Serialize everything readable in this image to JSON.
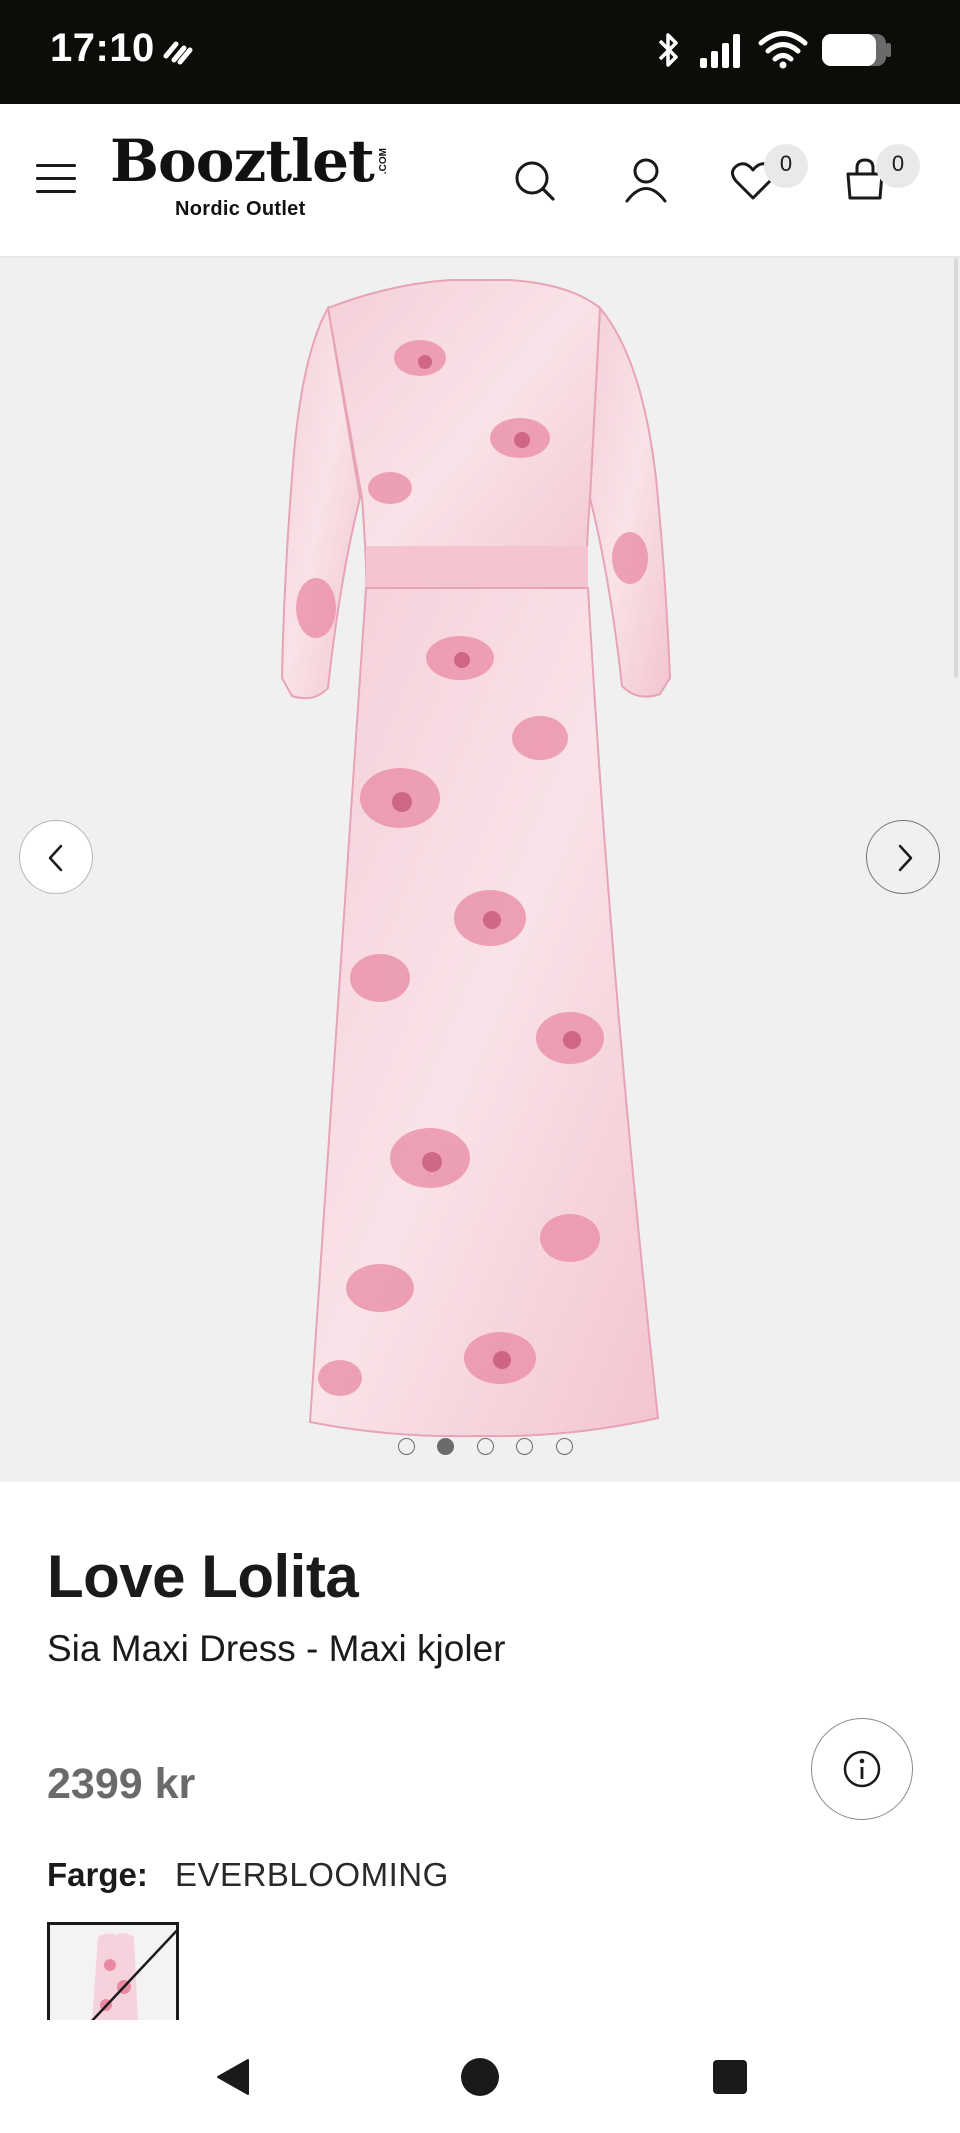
{
  "status_bar": {
    "time": "17:10",
    "icons": [
      "link-icon",
      "bluetooth-icon",
      "signal-icon",
      "wifi-icon",
      "battery-icon"
    ]
  },
  "header": {
    "logo_text": "Booztlet",
    "logo_suffix": ".COM",
    "logo_subtitle": "Nordic Outlet",
    "wishlist_count": "0",
    "cart_count": "0",
    "icons": [
      "menu-icon",
      "search-icon",
      "user-icon",
      "heart-icon",
      "bag-icon"
    ]
  },
  "gallery": {
    "image_count": 5,
    "active_index": 1
  },
  "product": {
    "brand": "Love Lolita",
    "name": "Sia Maxi Dress - Maxi kjoler",
    "price": "2399 kr",
    "color_label": "Farge:",
    "color_value": "EVERBLOOMING"
  },
  "colors": {
    "status_bar_bg": "#0e0c08",
    "gallery_bg": "#f1f0f0",
    "dress_base": "#f7dde3",
    "dress_print": "#e98aa4",
    "price_text": "#6a6a6a"
  }
}
